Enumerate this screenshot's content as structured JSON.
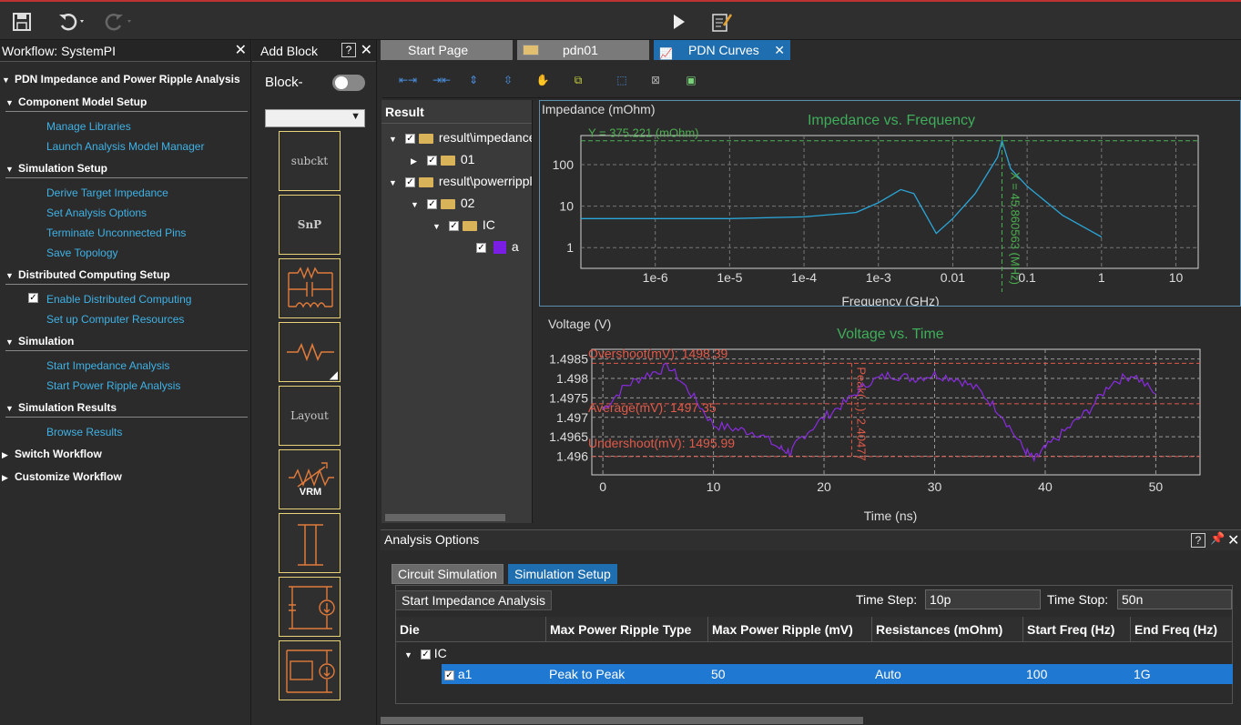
{
  "toolbar": {
    "save_icon": "save-icon",
    "undo_icon": "undo-icon",
    "redo_icon": "redo-icon",
    "run_icon": "play-icon",
    "report_icon": "report-icon"
  },
  "workflow": {
    "title": "Workflow: SystemPI",
    "root": "PDN Impedance and Power Ripple Analysis",
    "sections": [
      {
        "title": "Component Model Setup",
        "items": [
          "Manage Libraries",
          "Launch Analysis Model Manager"
        ]
      },
      {
        "title": "Simulation Setup",
        "items": [
          "Derive Target Impedance",
          "Set Analysis Options",
          "Terminate Unconnected Pins",
          "Save Topology"
        ]
      },
      {
        "title": "Distributed Computing Setup",
        "items": [
          "Enable Distributed Computing",
          "Set up Computer Resources"
        ]
      },
      {
        "title": "Simulation",
        "items": [
          "Start Impedance Analysis",
          "Start Power Ripple Analysis"
        ]
      },
      {
        "title": "Simulation Results",
        "items": [
          "Browse Results"
        ]
      }
    ],
    "switch": "Switch Workflow",
    "customize": "Customize Workflow"
  },
  "addblock": {
    "title": "Add Block",
    "help": "?",
    "toggle_label": "Block-",
    "blocks": [
      "subckt",
      "SnP",
      "Layout",
      "VRM"
    ]
  },
  "tabs": [
    {
      "label": "Start Page"
    },
    {
      "label": "pdn01"
    },
    {
      "label": "PDN Curves"
    }
  ],
  "result": {
    "header": "Result",
    "nodes": [
      "result\\impedance",
      "01",
      "result\\powerripple",
      "02",
      "IC",
      "a"
    ]
  },
  "impedance_plot": {
    "ylabel": "Impedance (mOhm)",
    "title": "Impedance vs. Frequency",
    "xlabel": "Frequency (GHz)",
    "marker_y": "Y = 375.221 (mOhm)",
    "marker_x": "X = 45.860563 (MHz)",
    "yticks": [
      "100",
      "10",
      "1"
    ],
    "xticks": [
      "1e-6",
      "1e-5",
      "1e-4",
      "1e-3",
      "0.01",
      "0.1",
      "1",
      "10"
    ]
  },
  "voltage_plot": {
    "ylabel": "Voltage (V)",
    "title": "Voltage vs. Time",
    "xlabel": "Time (ns)",
    "overshoot": "Overshoot(mV): 1498.39",
    "average": "Average(mV): 1497.35",
    "undershoot": "Undershoot(mV): 1495.99",
    "peak": "Peak(...): 2.40477",
    "yticks": [
      "1.4985",
      "1.498",
      "1.4975",
      "1.497",
      "1.4965",
      "1.496"
    ],
    "xticks": [
      "0",
      "10",
      "20",
      "30",
      "40",
      "50"
    ]
  },
  "chart_data": [
    {
      "type": "line",
      "title": "Impedance vs. Frequency",
      "xlabel": "Frequency (GHz)",
      "ylabel": "Impedance (mOhm)",
      "xscale": "log",
      "yscale": "log",
      "x": [
        1e-07,
        1e-06,
        1e-05,
        0.0001,
        0.0005,
        0.001,
        0.002,
        0.003,
        0.004,
        0.006,
        0.01,
        0.02,
        0.04,
        0.04586,
        0.06,
        0.1,
        0.3,
        1
      ],
      "y": [
        5,
        5,
        5,
        5.5,
        7,
        12,
        25,
        20,
        8,
        2.2,
        5,
        20,
        150,
        375,
        80,
        30,
        6,
        1.8
      ],
      "grid": true
    },
    {
      "type": "line",
      "title": "Voltage vs. Time",
      "xlabel": "Time (ns)",
      "ylabel": "Voltage (V)",
      "x": [
        0,
        2,
        4,
        6,
        8,
        10,
        12,
        14,
        16,
        17,
        18,
        20,
        22,
        24,
        26,
        28,
        30,
        32,
        34,
        36,
        38,
        39,
        40,
        42,
        44,
        46,
        48,
        50
      ],
      "y": [
        1.4972,
        1.4978,
        1.4981,
        1.4983,
        1.4976,
        1.4968,
        1.4967,
        1.4966,
        1.4962,
        1.4961,
        1.4965,
        1.497,
        1.4974,
        1.4979,
        1.4981,
        1.498,
        1.4981,
        1.498,
        1.4977,
        1.4971,
        1.4962,
        1.4959,
        1.4962,
        1.4967,
        1.4972,
        1.4979,
        1.4981,
        1.4976
      ],
      "grid": true
    }
  ],
  "analysis": {
    "title": "Analysis Options",
    "help": "?",
    "tab_circuit": "Circuit Simulation",
    "tab_sim": "Simulation Setup",
    "start_button": "Start Impedance Analysis",
    "time_step_label": "Time Step:",
    "time_step": "10p",
    "time_stop_label": "Time Stop:",
    "time_stop": "50n",
    "columns": [
      "Die",
      "Max Power Ripple Type",
      "Max Power Ripple (mV)",
      "Resistances (mOhm)",
      "Start Freq (Hz)",
      "End Freq (Hz)"
    ],
    "group": "IC",
    "row": {
      "die": "a1",
      "type": "Peak to Peak",
      "ripple": "50",
      "res": "Auto",
      "start": "100",
      "end": "1G"
    }
  }
}
